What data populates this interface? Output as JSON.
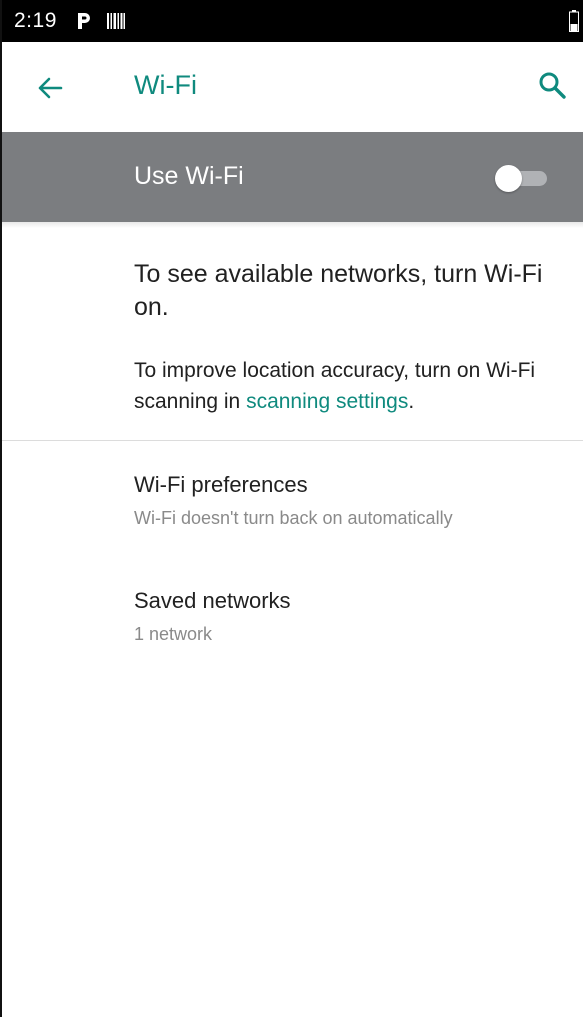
{
  "status_bar": {
    "time": "2:19",
    "icons": [
      "parking-p-icon",
      "barcode-icon",
      "battery-icon"
    ]
  },
  "app_bar": {
    "title": "Wi-Fi",
    "back_icon": "arrow-left-icon",
    "search_icon": "search-icon"
  },
  "master_switch": {
    "label": "Use Wi-Fi",
    "enabled": false
  },
  "info": {
    "main_text": "To see available networks, turn Wi-Fi on.",
    "sub_text_prefix": "To improve location accuracy, turn on Wi-Fi scanning in ",
    "sub_link": "scanning settings",
    "sub_text_suffix": "."
  },
  "preferences": [
    {
      "title": "Wi-Fi preferences",
      "summary": "Wi-Fi doesn't turn back on automatically"
    },
    {
      "title": "Saved networks",
      "summary": "1 network"
    }
  ],
  "colors": {
    "accent": "#0f8a7e",
    "master_bar": "#7b7d80",
    "status_bar": "#000000"
  }
}
